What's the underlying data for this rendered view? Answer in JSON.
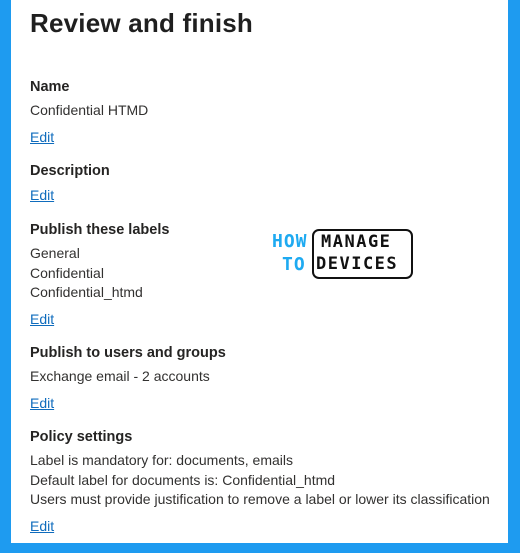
{
  "page": {
    "title": "Review and finish"
  },
  "logo": {
    "how": "HOW",
    "to": "TO",
    "manage": "MANAGE",
    "devices": "DEVICES",
    "colors": {
      "accent": "#1eaaf1",
      "dark": "#111111"
    }
  },
  "sections": {
    "name": {
      "title": "Name",
      "value": "Confidential HTMD",
      "edit": "Edit"
    },
    "description": {
      "title": "Description",
      "edit": "Edit"
    },
    "labels": {
      "title": "Publish these labels",
      "items": [
        "General",
        "Confidential",
        "Confidential_htmd"
      ],
      "edit": "Edit"
    },
    "users": {
      "title": "Publish to users and groups",
      "value": "Exchange email - 2 accounts",
      "edit": "Edit"
    },
    "policy": {
      "title": "Policy settings",
      "lines": [
        "Label is mandatory for: documents, emails",
        "Default label for documents is: Confidential_htmd",
        "Users must provide justification to remove a label or lower its classification"
      ],
      "edit": "Edit"
    }
  },
  "colors": {
    "background_border": "#1e9bf0",
    "link": "#0f6cbd",
    "text": "#323130"
  }
}
